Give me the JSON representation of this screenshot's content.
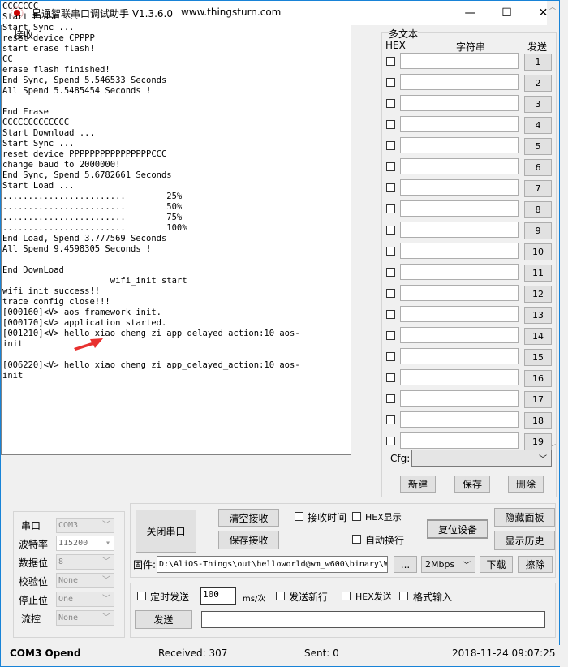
{
  "window": {
    "title": "星通智联串口调试助手 V1.3.6.0",
    "url": "www.thingsturn.com",
    "minimize": "—",
    "maximize": "☐",
    "close": "✕"
  },
  "receive": {
    "label": "接收",
    "log": [
      "CCCCCCC",
      "Start Erase ...",
      "Start Sync ...",
      "reset device CPPPP",
      "start erase flash!",
      "CC",
      "erase flash finished!",
      "End Sync, Spend 5.546533 Seconds",
      "All Spend 5.5485454 Seconds !",
      "",
      "End Erase",
      "CCCCCCCCCCCCC",
      "Start Download ...",
      "Start Sync ...",
      "reset device PPPPPPPPPPPPPPPPCCC",
      "change baud to 2000000!",
      "End Sync, Spend 5.6782661 Seconds",
      "Start Load ...",
      "........................        25%",
      "........................        50%",
      "........................        75%",
      "........................        100%",
      "End Load, Spend 3.777569 Seconds",
      "All Spend 9.4598305 Seconds !",
      "",
      "End DownLoad",
      "                     wifi_init start",
      "wifi init success!!",
      "trace config close!!!",
      "[000160]<V> aos framework init.",
      "[000170]<V> application started.",
      "[001210]<V> hello xiao cheng zi app_delayed_action:10 aos-",
      "init",
      "",
      "[006220]<V> hello xiao cheng zi app_delayed_action:10 aos-",
      "init"
    ],
    "annotation_color": "#e8312f"
  },
  "multi": {
    "label": "多文本",
    "col_hex": "HEX",
    "col_str": "字符串",
    "col_send": "发送",
    "rows": [
      "1",
      "2",
      "3",
      "4",
      "5",
      "6",
      "7",
      "8",
      "9",
      "10",
      "11",
      "12",
      "13",
      "14",
      "15",
      "16",
      "17",
      "18",
      "19"
    ],
    "cfg_label": "Cfg:",
    "new": "新建",
    "save": "保存",
    "delete": "删除"
  },
  "serial": {
    "port_label": "串口",
    "port": "COM3",
    "baud_label": "波特率",
    "baud": "115200",
    "data_label": "数据位",
    "data": "8",
    "parity_label": "校验位",
    "parity": "None",
    "stop_label": "停止位",
    "stop": "One",
    "flow_label": "流控",
    "flow": "None"
  },
  "controls": {
    "close_port": "关闭串口",
    "clear_recv": "清空接收",
    "save_recv": "保存接收",
    "recv_time": "接收时间",
    "hex_show": "HEX显示",
    "auto_wrap": "自动换行",
    "reset_dev": "复位设备",
    "hide_panel": "隐藏面板",
    "show_history": "显示历史",
    "firmware_label": "固件:",
    "firmware_path": "D:\\AliOS-Things\\out\\helloworld@wm_w600\\binary\\W",
    "browse": "...",
    "speed": "2Mbps",
    "download": "下载",
    "erase": "擦除"
  },
  "send": {
    "timed": "定时发送",
    "interval": "100",
    "unit": "ms/次",
    "newline": "发送新行",
    "hex_send": "HEX发送",
    "format_input": "格式输入",
    "send": "发送",
    "text": ""
  },
  "status": {
    "port": "COM3 Opend",
    "received": "Received: 307",
    "sent": "Sent: 0",
    "datetime": "2018-11-24 09:07:25"
  }
}
